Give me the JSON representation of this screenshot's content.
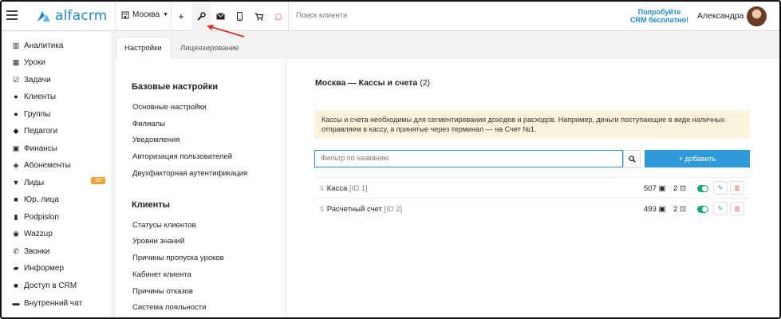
{
  "header": {
    "logo_text": "alfacrm",
    "branch": "Москва",
    "search_placeholder": "Поиск клиента",
    "promo": "Попробуйте CRM бесплатно!",
    "user_name": "Александра",
    "icons": [
      "menu-icon",
      "plus-icon",
      "wrench-icon",
      "mail-icon",
      "phone-icon",
      "cart-icon",
      "bell-icon"
    ]
  },
  "sidebar": {
    "items": [
      {
        "label": "Аналитика",
        "icon": "analytics-icon"
      },
      {
        "label": "Уроки",
        "icon": "calendar-icon"
      },
      {
        "label": "Задачи",
        "icon": "tasks-icon"
      },
      {
        "label": "Клиенты",
        "icon": "user-icon"
      },
      {
        "label": "Группы",
        "icon": "group-icon"
      },
      {
        "label": "Педагоги",
        "icon": "graduation-cap-icon"
      },
      {
        "label": "Финансы",
        "icon": "money-icon"
      },
      {
        "label": "Абонементы",
        "icon": "ticket-icon"
      },
      {
        "label": "Лиды",
        "icon": "funnel-icon",
        "badge": "20"
      },
      {
        "label": "Юр. лица",
        "icon": "briefcase-icon"
      },
      {
        "label": "Podpislon",
        "icon": "document-icon"
      },
      {
        "label": "Wazzup",
        "icon": "chat-icon"
      },
      {
        "label": "Звонки",
        "icon": "phone-icon"
      },
      {
        "label": "Информер",
        "icon": "info-icon"
      },
      {
        "label": "Доступ в CRM",
        "icon": "lock-icon"
      },
      {
        "label": "Внутренний чат",
        "icon": "message-icon"
      }
    ]
  },
  "tabs": [
    {
      "label": "Настройки",
      "active": true
    },
    {
      "label": "Лицензирование",
      "active": false
    }
  ],
  "settings": {
    "basic_heading": "Базовые настройки",
    "basic_links": [
      "Основные настройки",
      "Филиалы",
      "Уведомления",
      "Авторизация пользователей",
      "Двухфакторная аутентификация"
    ],
    "clients_heading": "Клиенты",
    "clients_links": [
      "Статусы клиентов",
      "Уровни знаний",
      "Причины пропуска уроков",
      "Кабинет клиента",
      "Причины отказов",
      "Система лояльности"
    ]
  },
  "main": {
    "title": "Москва — Кассы и счета",
    "count": "(2)",
    "info": "Кассы и счета необходимы для сегментирования доходов и расходов. Например, деньги поступающие в виде наличных отправляем в кассу, а принятые через терминал — на Счет №1.",
    "filter_placeholder": "Фильтр по названию",
    "add_label": "+ добавить",
    "rows": [
      {
        "name": "Касса",
        "id": "[ID 1]",
        "amount": "507",
        "count": "2",
        "enabled": true
      },
      {
        "name": "Расчетный счет",
        "id": "[ID 2]",
        "amount": "493",
        "count": "2",
        "enabled": true
      }
    ]
  },
  "colors": {
    "accent": "#1e88c8",
    "add_button": "#2f9ad8",
    "badge": "#f5a33a",
    "toggle_on": "#1aa676",
    "info_bg": "#fbf4dc"
  }
}
